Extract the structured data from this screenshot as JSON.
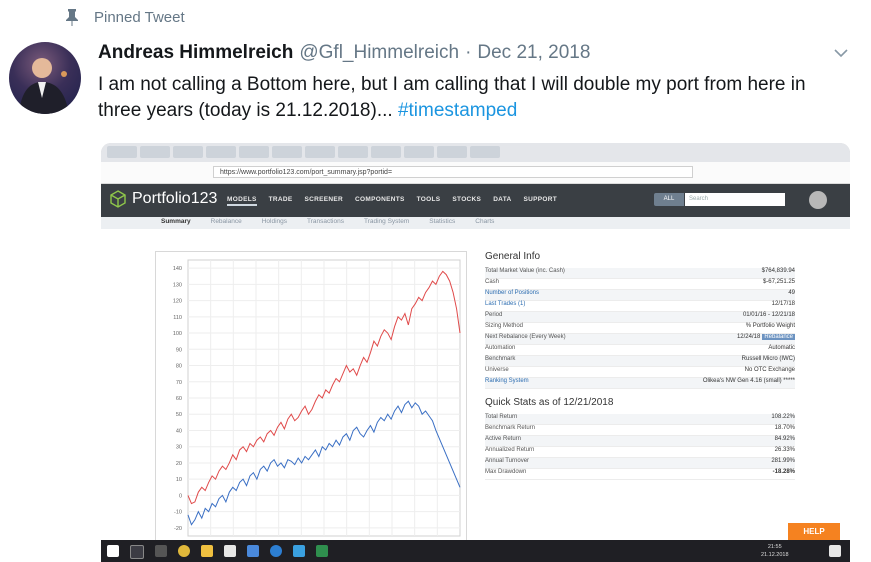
{
  "pinned_label": "Pinned Tweet",
  "tweet": {
    "author_name": "Andreas Himmelreich",
    "handle": "@Gfl_Himmelreich",
    "separator": "·",
    "date": "Dec 21, 2018",
    "text_before_hashtag": "I am not calling a Bottom here, but I am calling that I will double my port from here in three years (today is 21.12.2018)... ",
    "hashtag": "#timestamped"
  },
  "screenshot": {
    "url": "https://www.portfolio123.com/port_summary.jsp?portid=",
    "app_name": "Portfolio123",
    "nav": [
      "MODELS",
      "TRADE",
      "SCREENER",
      "COMPONENTS",
      "TOOLS",
      "STOCKS",
      "DATA",
      "SUPPORT"
    ],
    "search_scope": "ALL",
    "search_placeholder": "Search",
    "subtabs": [
      "Summary",
      "Rebalance",
      "Holdings",
      "Transactions",
      "Trading System",
      "Statistics",
      "Charts"
    ],
    "general_info_title": "General Info",
    "general_info": [
      {
        "k": "Total Market Value (inc. Cash)",
        "v": "$764,839.94"
      },
      {
        "k": "Cash",
        "v": "$-67,251.25"
      },
      {
        "k": "Number of Positions",
        "v": "49"
      },
      {
        "k": "Last Trades (1)",
        "v": "12/17/18"
      },
      {
        "k": "Period",
        "v": "01/01/16 - 12/21/18"
      },
      {
        "k": "Sizing Method",
        "v": "% Portfolio Weight"
      },
      {
        "k": "Next Rebalance (Every Week)",
        "v": "12/24/18"
      },
      {
        "k": "Automation",
        "v": "Automatic"
      },
      {
        "k": "Benchmark",
        "v": "Russell Micro (IWC)"
      },
      {
        "k": "Universe",
        "v": "No OTC Exchange"
      },
      {
        "k": "Ranking System",
        "v": "Olikea's NW Gen 4.16 (small) *****"
      }
    ],
    "rebalance_badge": "Rebalance",
    "quick_stats_title": "Quick Stats as of 12/21/2018",
    "quick_stats": [
      {
        "k": "Total Return",
        "v": "108.22%"
      },
      {
        "k": "Benchmark Return",
        "v": "18.70%"
      },
      {
        "k": "Active Return",
        "v": "84.92%"
      },
      {
        "k": "Annualized Return",
        "v": "26.33%"
      },
      {
        "k": "Annual Turnover",
        "v": "281.99%"
      },
      {
        "k": "Max Drawdown",
        "v": "-18.28%"
      }
    ],
    "help_label": "HELP",
    "clock_time": "21:55",
    "clock_date": "21.12.2018",
    "chart_yticks": [
      "140",
      "130",
      "120",
      "110",
      "100",
      "90",
      "80",
      "70",
      "60",
      "50",
      "40",
      "30",
      "20",
      "10",
      "0",
      "-10",
      "-20"
    ]
  },
  "chart_data": {
    "type": "line",
    "ylim": [
      -25,
      145
    ],
    "yticks": [
      140,
      130,
      120,
      110,
      100,
      90,
      80,
      70,
      60,
      50,
      40,
      30,
      20,
      10,
      0,
      -10,
      -20
    ],
    "x": [
      0,
      1,
      2,
      3,
      4,
      5,
      6,
      7,
      8,
      9,
      10,
      11,
      12,
      13,
      14,
      15,
      16,
      17,
      18,
      19,
      20,
      21,
      22,
      23,
      24,
      25,
      26,
      27,
      28,
      29,
      30,
      31,
      32,
      33,
      34,
      35,
      36,
      37,
      38,
      39,
      40,
      41,
      42,
      43,
      44,
      45,
      46,
      47,
      48,
      49,
      50,
      51,
      52,
      53,
      54,
      55,
      56,
      57,
      58,
      59,
      60,
      61,
      62,
      63,
      64,
      65,
      66,
      67,
      68,
      69,
      70,
      71,
      72,
      73,
      74,
      75,
      76,
      77,
      78,
      79
    ],
    "series": [
      {
        "color": "#e04a4a",
        "values": [
          0,
          -5,
          -4,
          2,
          5,
          3,
          8,
          12,
          10,
          15,
          18,
          16,
          20,
          25,
          22,
          28,
          30,
          27,
          32,
          30,
          34,
          36,
          33,
          38,
          40,
          37,
          42,
          45,
          41,
          47,
          50,
          46,
          48,
          52,
          55,
          50,
          53,
          58,
          62,
          60,
          65,
          63,
          68,
          72,
          70,
          75,
          80,
          76,
          78,
          74,
          80,
          85,
          82,
          88,
          95,
          92,
          98,
          102,
          100,
          96,
          104,
          110,
          108,
          112,
          105,
          115,
          118,
          122,
          120,
          125,
          128,
          132,
          130,
          135,
          138,
          136,
          132,
          125,
          115,
          100
        ]
      },
      {
        "color": "#3a6fc4",
        "values": [
          -12,
          -18,
          -15,
          -10,
          -14,
          -8,
          -10,
          -5,
          -7,
          -2,
          0,
          -4,
          2,
          5,
          3,
          8,
          10,
          6,
          12,
          14,
          10,
          16,
          18,
          15,
          20,
          22,
          18,
          20,
          17,
          22,
          21,
          19,
          23,
          20,
          24,
          22,
          25,
          28,
          24,
          30,
          28,
          32,
          30,
          34,
          31,
          36,
          38,
          34,
          40,
          42,
          38,
          36,
          40,
          43,
          39,
          45,
          48,
          46,
          50,
          47,
          52,
          55,
          51,
          56,
          58,
          54,
          57,
          55,
          50,
          52,
          49,
          46,
          40,
          35,
          30,
          25,
          20,
          15,
          10,
          5
        ]
      }
    ]
  }
}
